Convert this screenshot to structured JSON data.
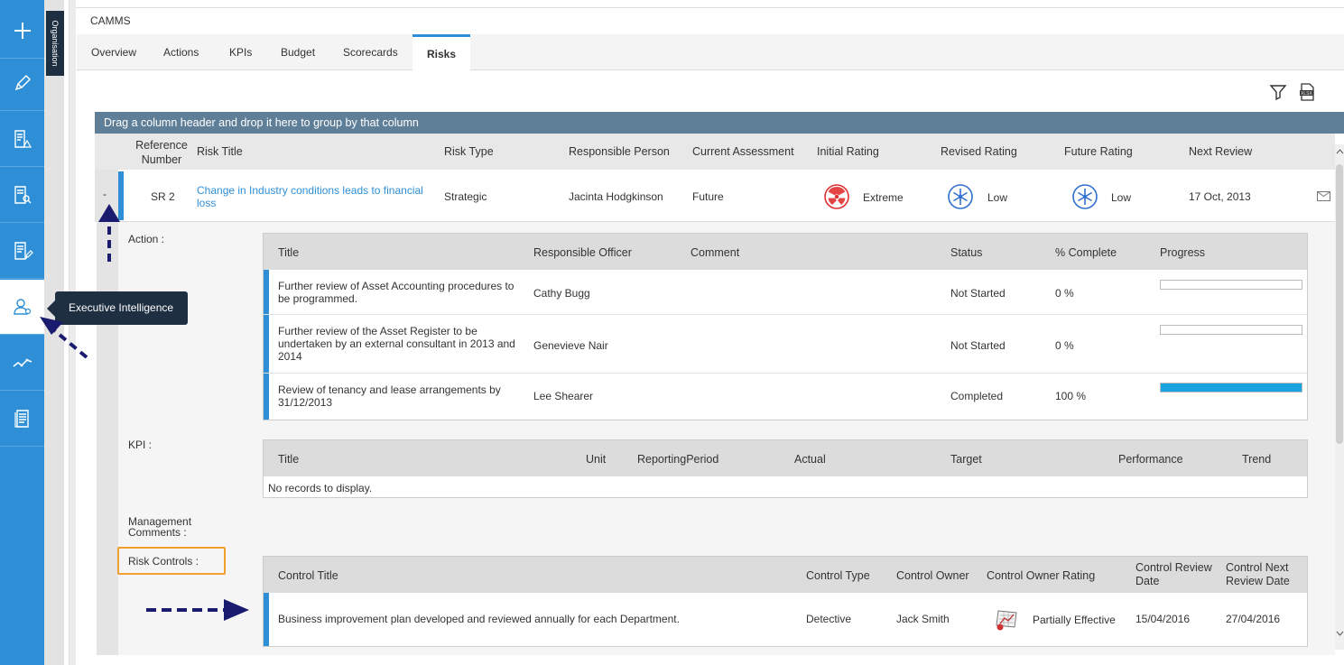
{
  "app": {
    "title": "CAMMS",
    "org_tab": "Organisation"
  },
  "rail": {
    "items": [
      {
        "icon": "plus-icon"
      },
      {
        "icon": "pencil-icon"
      },
      {
        "icon": "document-warning-icon"
      },
      {
        "icon": "document-search-icon"
      },
      {
        "icon": "document-edit-icon"
      },
      {
        "icon": "people-icon",
        "active": true
      },
      {
        "icon": "trend-icon"
      },
      {
        "icon": "report-icon"
      }
    ],
    "tooltip": "Executive Intelligence"
  },
  "tabs": [
    "Overview",
    "Actions",
    "KPIs",
    "Budget",
    "Scorecards",
    "Risks"
  ],
  "active_tab": "Risks",
  "group_bar": "Drag a column header and drop it here to group by that column",
  "grid": {
    "columns": [
      "Reference Number",
      "Risk Title",
      "Risk Type",
      "Responsible Person",
      "Current Assessment",
      "Initial Rating",
      "Revised Rating",
      "Future Rating",
      "Next Review"
    ],
    "row": {
      "expand": "-",
      "reference": "SR 2",
      "title": "Change in Industry conditions leads to financial loss",
      "type": "Strategic",
      "responsible": "Jacinta Hodgkinson",
      "assessment": "Future",
      "initial_rating": "Extreme",
      "revised_rating": "Low",
      "future_rating": "Low",
      "next_review": "17 Oct, 2013"
    }
  },
  "action": {
    "label": "Action :",
    "columns": [
      "Title",
      "Responsible Officer",
      "Comment",
      "Status",
      "% Complete",
      "Progress"
    ],
    "rows": [
      {
        "title": "Further review of Asset Accounting procedures to be programmed.",
        "officer": "Cathy Bugg",
        "comment": "",
        "status": "Not Started",
        "complete": "0 %",
        "progress": 0
      },
      {
        "title": "Further review of the Asset Register to be undertaken by an external consultant in 2013 and 2014",
        "officer": "Genevieve Nair",
        "comment": "",
        "status": "Not Started",
        "complete": "0 %",
        "progress": 0
      },
      {
        "title": "Review of tenancy and lease arrangements by 31/12/2013",
        "officer": "Lee Shearer",
        "comment": "",
        "status": "Completed",
        "complete": "100 %",
        "progress": 1
      }
    ]
  },
  "kpi": {
    "label": "KPI :",
    "columns": [
      "Title",
      "Unit",
      "ReportingPeriod",
      "Actual",
      "Target",
      "Performance",
      "Trend"
    ],
    "empty": "No records to display."
  },
  "management_comments": {
    "label": "Management Comments :"
  },
  "controls": {
    "label": "Risk Controls :",
    "columns": [
      "Control Title",
      "Control Type",
      "Control Owner",
      "Control Owner Rating",
      "Control Review Date",
      "Control Next Review Date"
    ],
    "rows": [
      {
        "title": "Business improvement plan developed and reviewed annually for each Department.",
        "type": "Detective",
        "owner": "Jack Smith",
        "rating": "Partially Effective",
        "review_date": "15/04/2016",
        "next_review_date": "27/04/2016"
      }
    ]
  },
  "colors": {
    "accent": "#2e8fd6",
    "extreme": "#e03030",
    "low": "#2f6fd0",
    "annotation_arrow": "#1a1a6e",
    "highlight": "#f0a030"
  }
}
